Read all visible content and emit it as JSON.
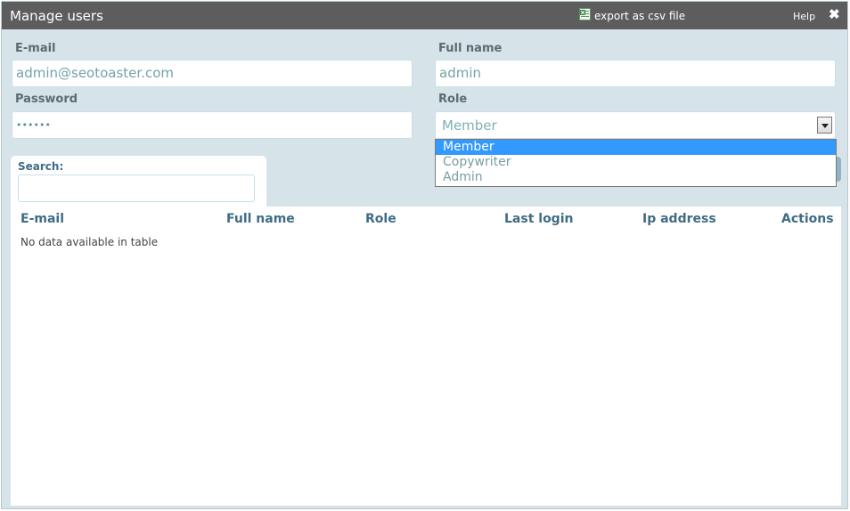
{
  "window": {
    "title": "Manage users",
    "export_label": "export as csv file",
    "help_label": "Help",
    "close_glyph": "✖"
  },
  "form": {
    "email": {
      "label": "E-mail",
      "value": "admin@seotoaster.com"
    },
    "fullname": {
      "label": "Full name",
      "value": "admin"
    },
    "password": {
      "label": "Password",
      "value": "••••••"
    },
    "role": {
      "label": "Role",
      "selected": "Member",
      "options": [
        "Member",
        "Copywriter",
        "Admin"
      ]
    }
  },
  "search": {
    "label": "Search:",
    "value": ""
  },
  "table": {
    "columns": [
      "E-mail",
      "Full name",
      "Role",
      "Last login",
      "Ip address",
      "Actions"
    ],
    "empty_message": "No data available in table"
  },
  "colors": {
    "titlebar": "#5d5d5d",
    "panel": "#d6e4ea",
    "header_text": "#3f6c84",
    "dropdown_highlight": "#3399ff"
  },
  "icons": {
    "export": "excel-file-icon",
    "close": "close-icon",
    "select": "chevron-down-icon"
  }
}
